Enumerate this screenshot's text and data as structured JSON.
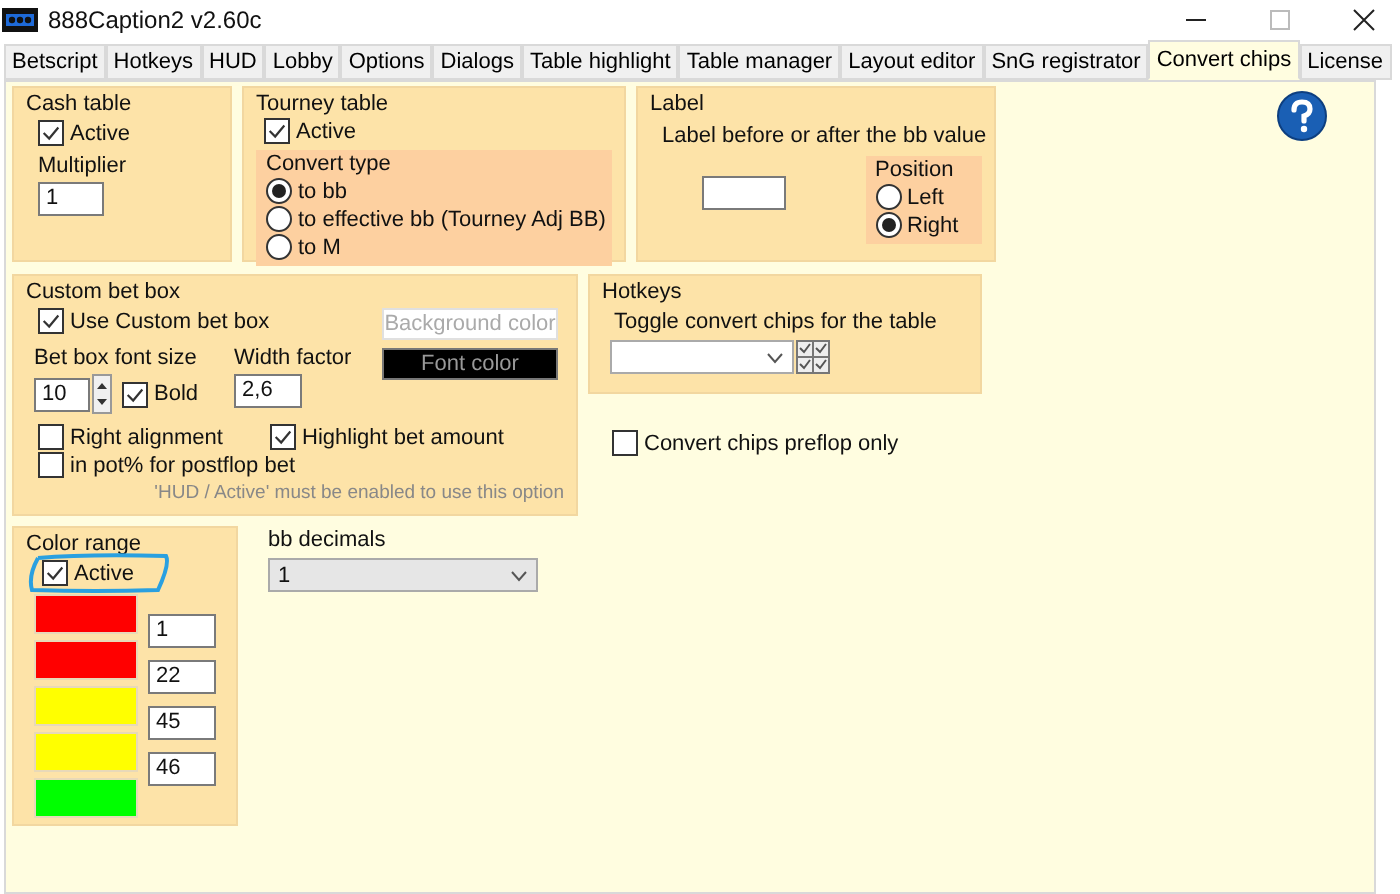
{
  "window": {
    "title": "888Caption2 v2.60c"
  },
  "tabs": [
    {
      "label": "Betscript",
      "selected": false
    },
    {
      "label": "Hotkeys",
      "selected": false
    },
    {
      "label": "HUD",
      "selected": false
    },
    {
      "label": "Lobby",
      "selected": false
    },
    {
      "label": "Options",
      "selected": false
    },
    {
      "label": "Dialogs",
      "selected": false
    },
    {
      "label": "Table highlight",
      "selected": false
    },
    {
      "label": "Table manager",
      "selected": false
    },
    {
      "label": "Layout editor",
      "selected": false
    },
    {
      "label": "SnG registrator",
      "selected": false
    },
    {
      "label": "Convert chips",
      "selected": true
    },
    {
      "label": "License",
      "selected": false
    }
  ],
  "cash_table": {
    "title": "Cash table",
    "active": {
      "label": "Active",
      "checked": true
    },
    "multiplier_label": "Multiplier",
    "multiplier": "1"
  },
  "tourney_table": {
    "title": "Tourney table",
    "active": {
      "label": "Active",
      "checked": true
    },
    "convert_type_title": "Convert type",
    "convert_type": [
      {
        "label": "to bb",
        "selected": true
      },
      {
        "label": "to effective bb (Tourney Adj BB)",
        "selected": false
      },
      {
        "label": "to M",
        "selected": false
      }
    ]
  },
  "label": {
    "title": "Label",
    "hint": "Label before or after the bb value",
    "position_title": "Position",
    "position": [
      {
        "label": "Left",
        "selected": false
      },
      {
        "label": "Right",
        "selected": true
      }
    ]
  },
  "custom_bet_box": {
    "title": "Custom bet box",
    "use": {
      "label": "Use Custom bet box",
      "checked": true
    },
    "background_color_button": "Background color",
    "font_color_button": "Font color",
    "font_size_label": "Bet box font size",
    "font_size": "10",
    "bold": {
      "label": "Bold",
      "checked": true
    },
    "width_factor_label": "Width factor",
    "width_factor": "2,6",
    "right_alignment": {
      "label": "Right alignment",
      "checked": false
    },
    "highlight": {
      "label": "Highlight bet amount",
      "checked": true
    },
    "in_pot": {
      "label": "in pot% for postflop bet",
      "checked": false
    },
    "note": "'HUD / Active' must be enabled to use this option"
  },
  "hotkeys": {
    "title": "Hotkeys",
    "toggle_label": "Toggle convert chips for the table"
  },
  "preflop_only": {
    "label": "Convert chips preflop only",
    "checked": false
  },
  "color_range": {
    "title": "Color range",
    "active": {
      "label": "Active",
      "checked": true
    },
    "swatches": [
      {
        "color": "#ff0000"
      },
      {
        "color": "#ff0000"
      },
      {
        "color": "#ffff00"
      },
      {
        "color": "#ffff00"
      },
      {
        "color": "#00ff00"
      }
    ],
    "thresholds": [
      "1",
      "22",
      "45",
      "46"
    ]
  },
  "bb_decimals": {
    "label": "bb decimals",
    "value": "1"
  }
}
